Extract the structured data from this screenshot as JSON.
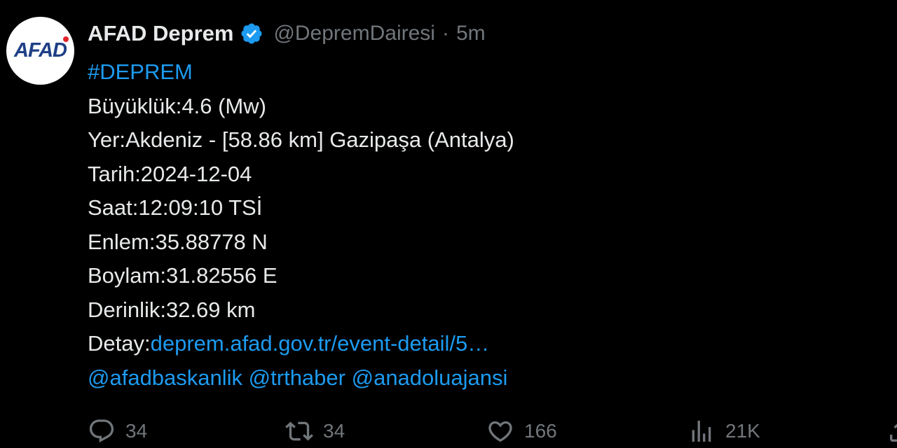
{
  "author": {
    "avatar_text": "AFAD",
    "display_name": "AFAD Deprem",
    "handle": "@DepremDairesi",
    "separator": "·",
    "time": "5m",
    "verified_icon": "verified-badge-icon"
  },
  "tweet": {
    "hashtag": "#DEPREM",
    "lines": [
      "Büyüklük:4.6 (Mw)",
      "Yer:Akdeniz - [58.86 km] Gazipaşa (Antalya)",
      "Tarih:2024-12-04",
      "Saat:12:09:10 TSİ",
      "Enlem:35.88778 N",
      "Boylam:31.82556 E",
      "Derinlik:32.69 km"
    ],
    "detail_label": "Detay:",
    "detail_link": "deprem.afad.gov.tr/event-detail/5…",
    "mentions": [
      "@afadbaskanlik",
      "@trthaber",
      "@anadoluajansi"
    ]
  },
  "actions": {
    "replies": "34",
    "reposts": "34",
    "likes": "166",
    "views": "21K"
  },
  "colors": {
    "background": "#000000",
    "text": "#e7e9ea",
    "muted": "#71767b",
    "link": "#1d9bf0"
  }
}
